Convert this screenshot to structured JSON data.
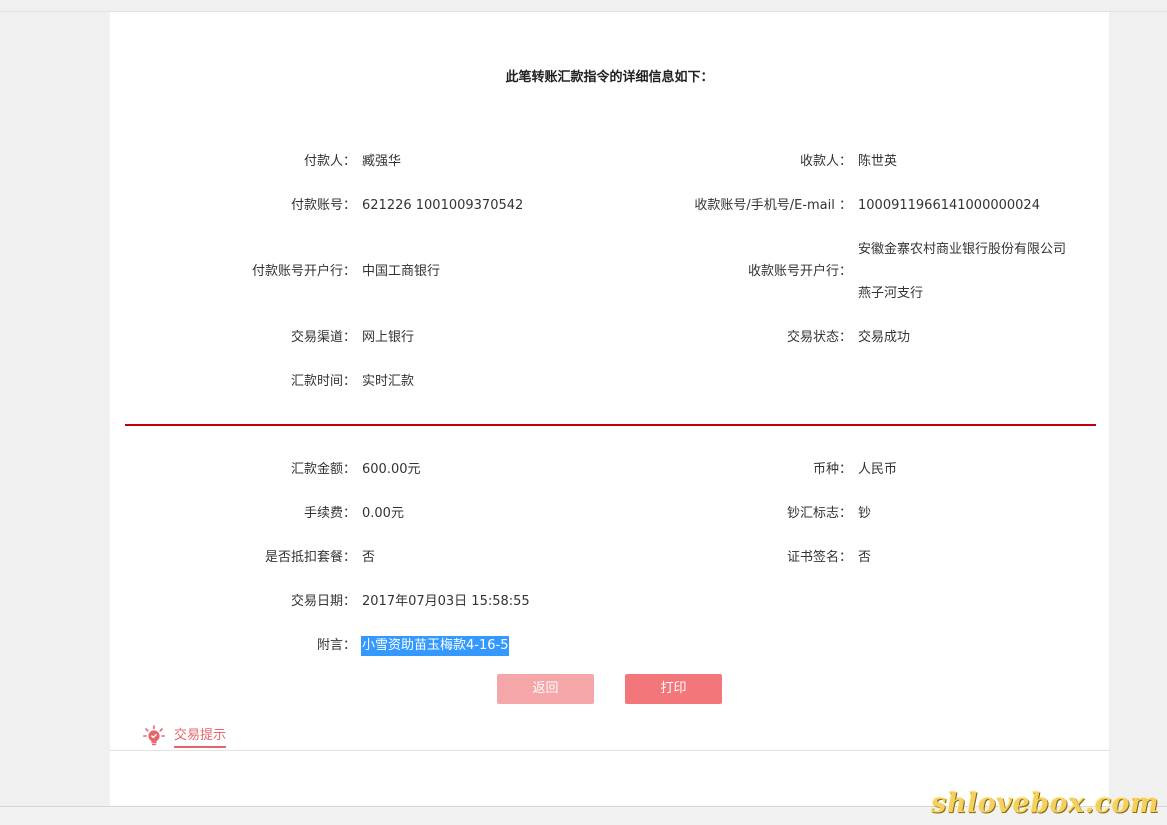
{
  "header": {
    "title": "此笔转账汇款指令的详细信息如下："
  },
  "transfer_info": [
    {
      "label": "付款人：",
      "value": "臧强华"
    },
    {
      "label": "收款人：",
      "value": "陈世英"
    },
    {
      "label": "付款账号：",
      "value": "621226 1001009370542"
    },
    {
      "label": "收款账号/手机号/E-mail ：",
      "value": "1000911966141000000024"
    },
    {
      "label": "付款账号开户行：",
      "value": "中国工商银行"
    },
    {
      "label": "收款账号开户行：",
      "value_line1": "安徽金寨农村商业银行股份有限公司",
      "value_line2": "燕子河支行"
    },
    {
      "label": "交易渠道：",
      "value": "网上银行"
    },
    {
      "label": "交易状态：",
      "value": "交易成功"
    },
    {
      "label": "汇款时间：",
      "value": "实时汇款"
    }
  ],
  "amount_info": [
    {
      "label": "汇款金额：",
      "value": "600.00元"
    },
    {
      "label": "币种：",
      "value": "人民币"
    },
    {
      "label": "手续费：",
      "value": "0.00元"
    },
    {
      "label": "钞汇标志：",
      "value": "钞"
    },
    {
      "label": "是否抵扣套餐：",
      "value": "否"
    },
    {
      "label": "证书签名：",
      "value": "否"
    },
    {
      "label": "交易日期：",
      "value": "2017年07月03日 15:58:55"
    },
    {
      "label": "附言：",
      "value": "小雪资助苗玉梅款4-16-5"
    }
  ],
  "buttons": {
    "back_label": "返回",
    "print_label": "打印"
  },
  "tips": {
    "label": "交易提示",
    "icon": "lightbulb-icon"
  },
  "watermark": {
    "text": "shlovebox.com"
  },
  "colors": {
    "divider": "#c0000a",
    "primary": "#f2767a",
    "primary_light": "#f5a6a9",
    "highlight": "#3399ff"
  }
}
